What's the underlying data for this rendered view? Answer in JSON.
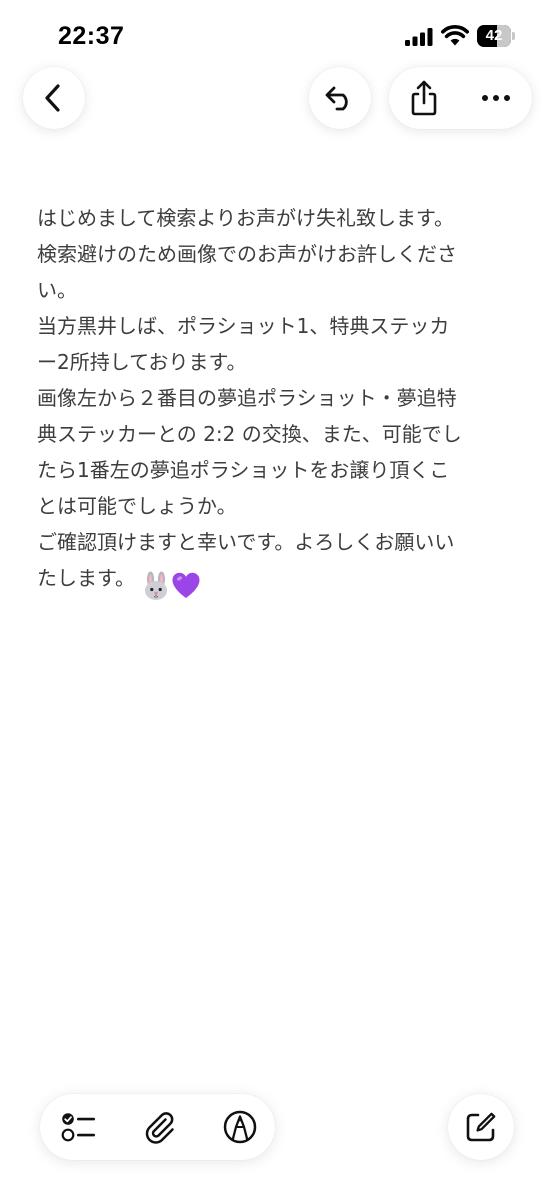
{
  "status_bar": {
    "time": "22:37",
    "battery_level": "42",
    "icons": [
      "signal-icon",
      "wifi-icon",
      "battery-icon"
    ]
  },
  "nav": {
    "icons": [
      "chevron-left-icon",
      "undo-icon",
      "share-icon",
      "more-icon"
    ]
  },
  "note": {
    "lines": [
      "はじめまして検索よりお声がけ失礼致します。",
      "検索避けのため画像でのお声がけお許しくださ",
      "い。",
      "当方黒井しば、ポラショット1、特典ステッカ",
      "ー2所持しております。",
      "画像左から２番目の夢追ポラショット・夢追特",
      "典ステッカーとの 2:2 の交換、また、可能でし",
      "たら1番左の夢追ポラショットをお譲り頂くこ",
      "とは可能でしょうか。",
      "ご確認頂けますと幸いです。よろしくお願いい",
      "たします。"
    ],
    "emojis": [
      "rabbit-face-emoji",
      "purple-heart-emoji"
    ]
  },
  "toolbar": {
    "icons": [
      "checklist-icon",
      "paperclip-icon",
      "markup-pen-icon",
      "compose-icon"
    ]
  }
}
